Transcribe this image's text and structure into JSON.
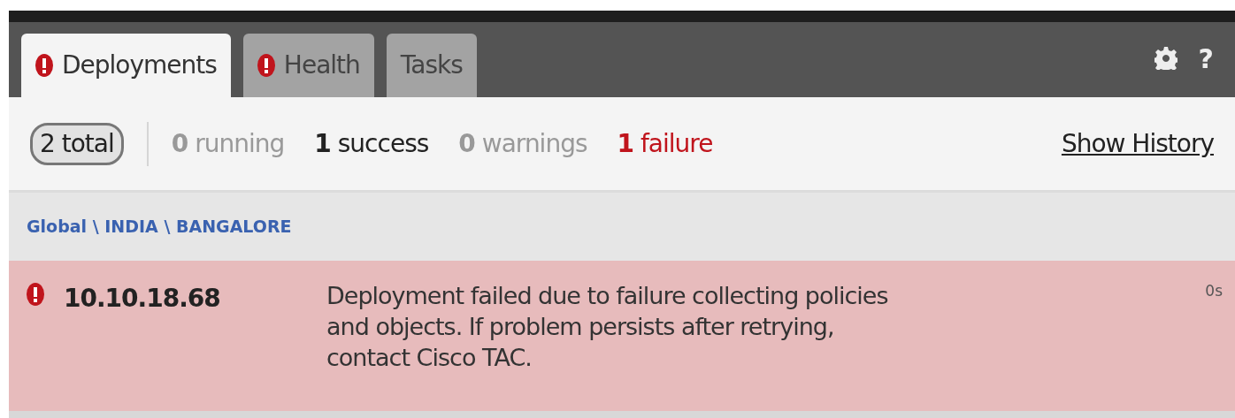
{
  "tabs": [
    {
      "label": "Deployments",
      "alert": true,
      "selected": true
    },
    {
      "label": "Health",
      "alert": true,
      "selected": false
    },
    {
      "label": "Tasks",
      "alert": false,
      "selected": false
    }
  ],
  "help": "?",
  "summary": {
    "total": "2 total",
    "stats": [
      {
        "kind": "running",
        "count": "0",
        "label": "running"
      },
      {
        "kind": "success",
        "count": "1",
        "label": "success"
      },
      {
        "kind": "warnings",
        "count": "0",
        "label": "warnings"
      },
      {
        "kind": "failure",
        "count": "1",
        "label": "failure"
      }
    ],
    "history_link": "Show History"
  },
  "group": "Global \\ INDIA \\ BANGALORE",
  "rows": [
    {
      "failed": true,
      "device": "10.10.18.68",
      "message": "Deployment failed due to failure collecting policies and objects. If problem persists after retrying, contact Cisco TAC.",
      "time": "0s"
    }
  ]
}
